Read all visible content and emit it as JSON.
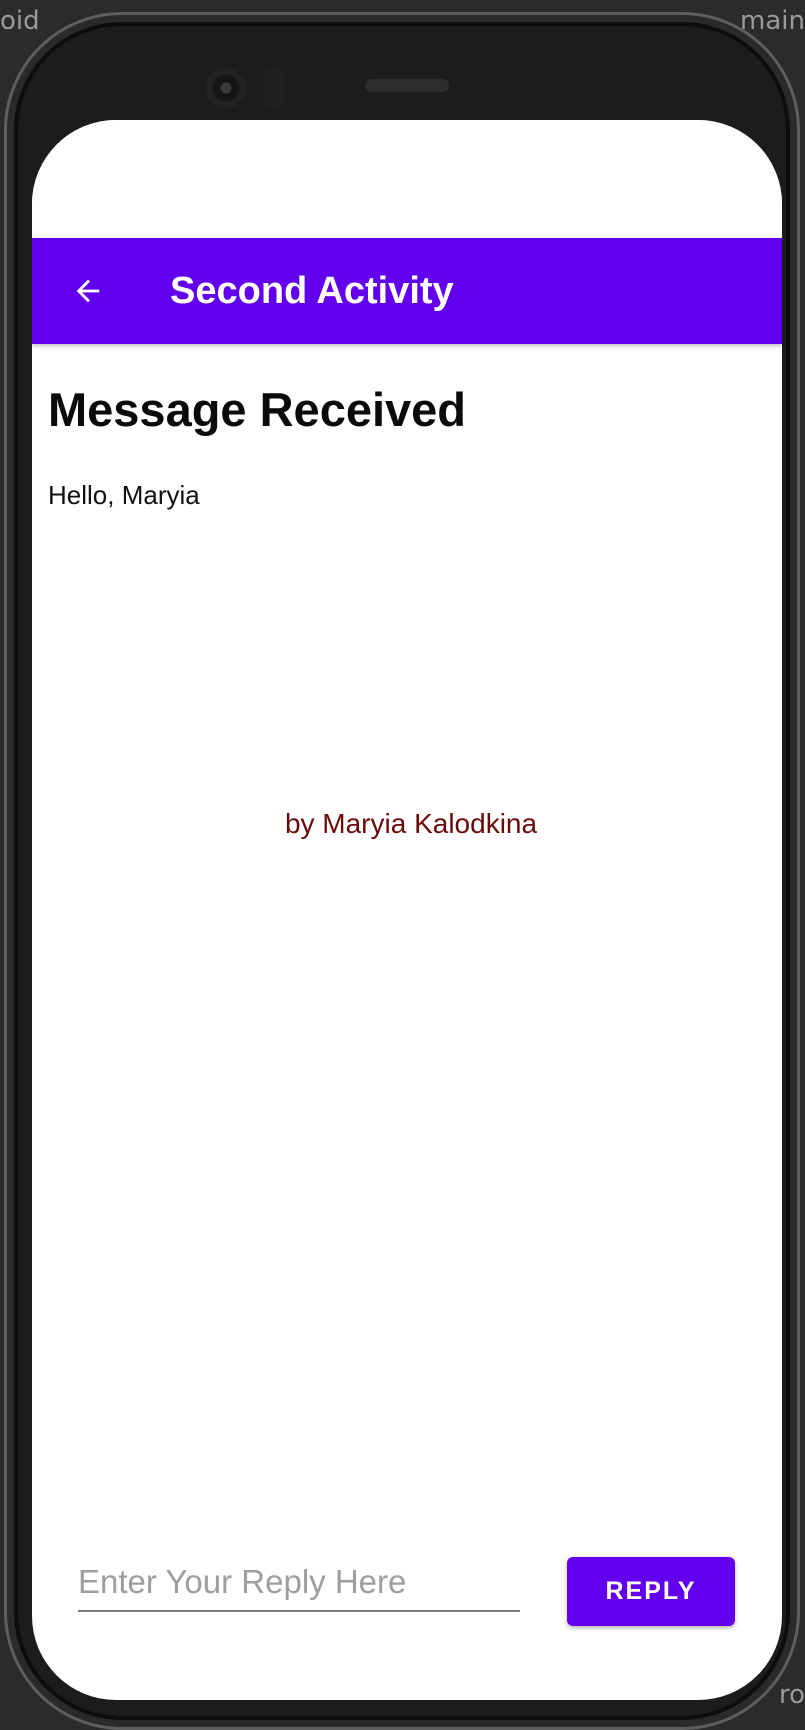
{
  "ide": {
    "left_fragment": "oid",
    "right_fragment": "main",
    "bottom_right_fragment": "ro"
  },
  "appbar": {
    "back_icon": "arrow-back-icon",
    "title": "Second Activity",
    "background_color": "#6200ee"
  },
  "content": {
    "heading": "Message Received",
    "message": "Hello, Maryia",
    "credit": "by Maryia Kalodkina",
    "credit_color": "#6a0a0a"
  },
  "reply": {
    "placeholder": "Enter Your Reply Here",
    "value": "",
    "button_label": "REPLY"
  }
}
